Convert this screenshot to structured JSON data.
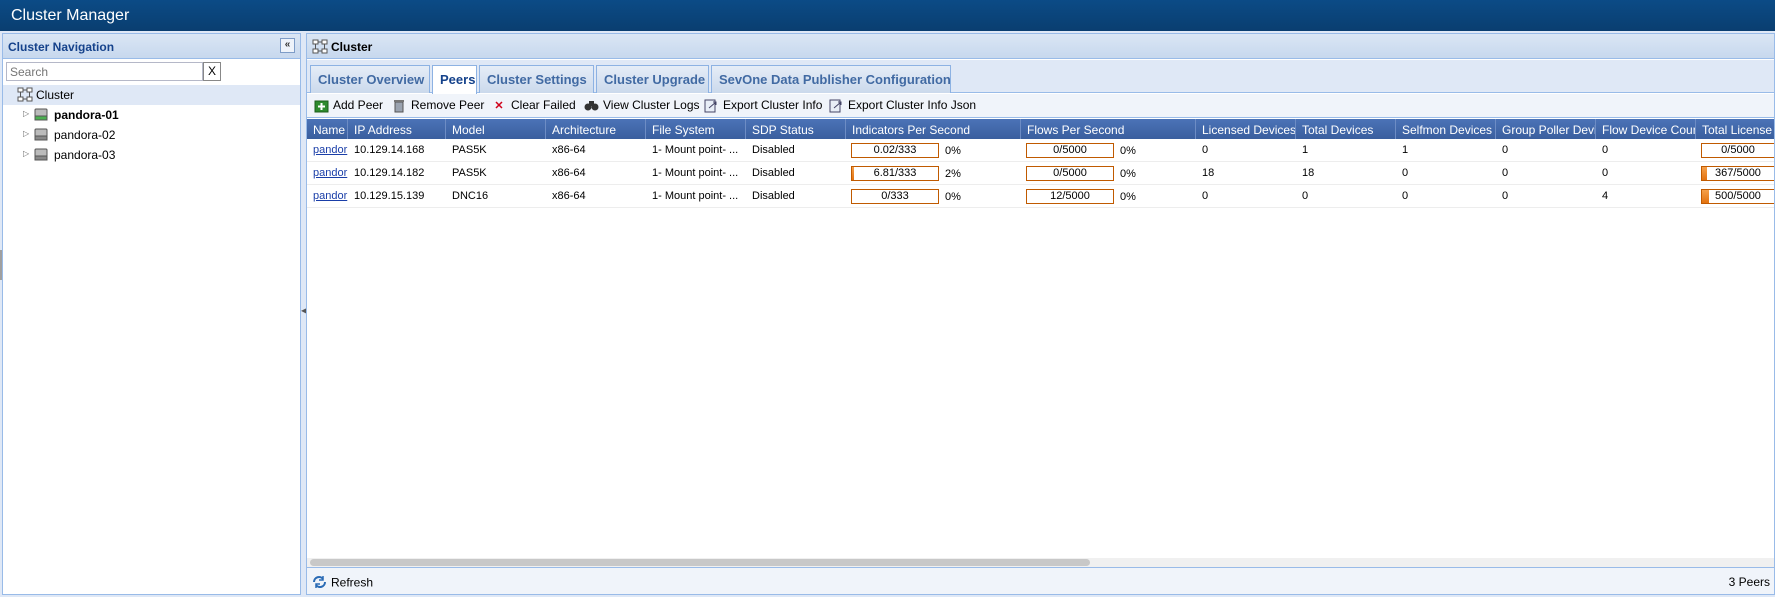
{
  "app": {
    "title": "Cluster Manager"
  },
  "navigation": {
    "title": "Cluster Navigation",
    "search_placeholder": "Search",
    "search_clear": "X",
    "root": "Cluster",
    "nodes": [
      {
        "label": "pandora-01",
        "bold": true
      },
      {
        "label": "pandora-02",
        "bold": false
      },
      {
        "label": "pandora-03",
        "bold": false
      }
    ]
  },
  "main": {
    "title": "Cluster",
    "tabs": [
      {
        "label": "Cluster Overview"
      },
      {
        "label": "Peers"
      },
      {
        "label": "Cluster Settings"
      },
      {
        "label": "Cluster Upgrade"
      },
      {
        "label": "SevOne Data Publisher Configuration"
      }
    ],
    "active_tab": "Peers",
    "toolbar": [
      {
        "label": "Add Peer",
        "icon": "add-peer-icon"
      },
      {
        "label": "Remove Peer",
        "icon": "trash-icon"
      },
      {
        "label": "Clear Failed",
        "icon": "x-icon"
      },
      {
        "label": "View Cluster Logs",
        "icon": "binoculars-icon"
      },
      {
        "label": "Export Cluster Info",
        "icon": "export-icon"
      },
      {
        "label": "Export Cluster Info Json",
        "icon": "export-json-icon"
      }
    ],
    "columns": [
      "Name",
      "IP Address",
      "Model",
      "Architecture",
      "File System",
      "SDP Status",
      "Indicators Per Second",
      "Flows Per Second",
      "Licensed Devices",
      "Total Devices",
      "Selfmon Devices",
      "Group Poller Device",
      "Flow Device Count",
      "Total License C"
    ],
    "rows": [
      {
        "name": "pandor",
        "ip": "10.129.14.168",
        "model": "PAS5K",
        "arch": "x86-64",
        "fs": "1- Mount point- ...",
        "sdp": "Disabled",
        "ips": {
          "text": "0.02/333",
          "fraction": 0.0,
          "pct": "0%"
        },
        "fps": {
          "text": "0/5000",
          "fraction": 0.0,
          "pct": "0%"
        },
        "licensed": "0",
        "total": "1",
        "selfmon": "1",
        "group_poller": "0",
        "flow_count": "0",
        "license": {
          "text": "0/5000",
          "fraction": 0.0
        }
      },
      {
        "name": "pandor",
        "ip": "10.129.14.182",
        "model": "PAS5K",
        "arch": "x86-64",
        "fs": "1- Mount point- ...",
        "sdp": "Disabled",
        "ips": {
          "text": "6.81/333",
          "fraction": 0.02,
          "pct": "2%"
        },
        "fps": {
          "text": "0/5000",
          "fraction": 0.0,
          "pct": "0%"
        },
        "licensed": "18",
        "total": "18",
        "selfmon": "0",
        "group_poller": "0",
        "flow_count": "0",
        "license": {
          "text": "367/5000",
          "fraction": 0.07
        }
      },
      {
        "name": "pandor",
        "ip": "10.129.15.139",
        "model": "DNC16",
        "arch": "x86-64",
        "fs": "1- Mount point- ...",
        "sdp": "Disabled",
        "ips": {
          "text": "0/333",
          "fraction": 0.0,
          "pct": "0%"
        },
        "fps": {
          "text": "12/5000",
          "fraction": 0.0,
          "pct": "0%"
        },
        "licensed": "0",
        "total": "0",
        "selfmon": "0",
        "group_poller": "0",
        "flow_count": "4",
        "license": {
          "text": "500/5000",
          "fraction": 0.1
        }
      }
    ],
    "status": {
      "refresh_label": "Refresh",
      "count_label": "3 Peers"
    }
  },
  "colors": {
    "accent": "#0b4b86",
    "header": "#4b73b7",
    "progress": "#e3720f"
  }
}
